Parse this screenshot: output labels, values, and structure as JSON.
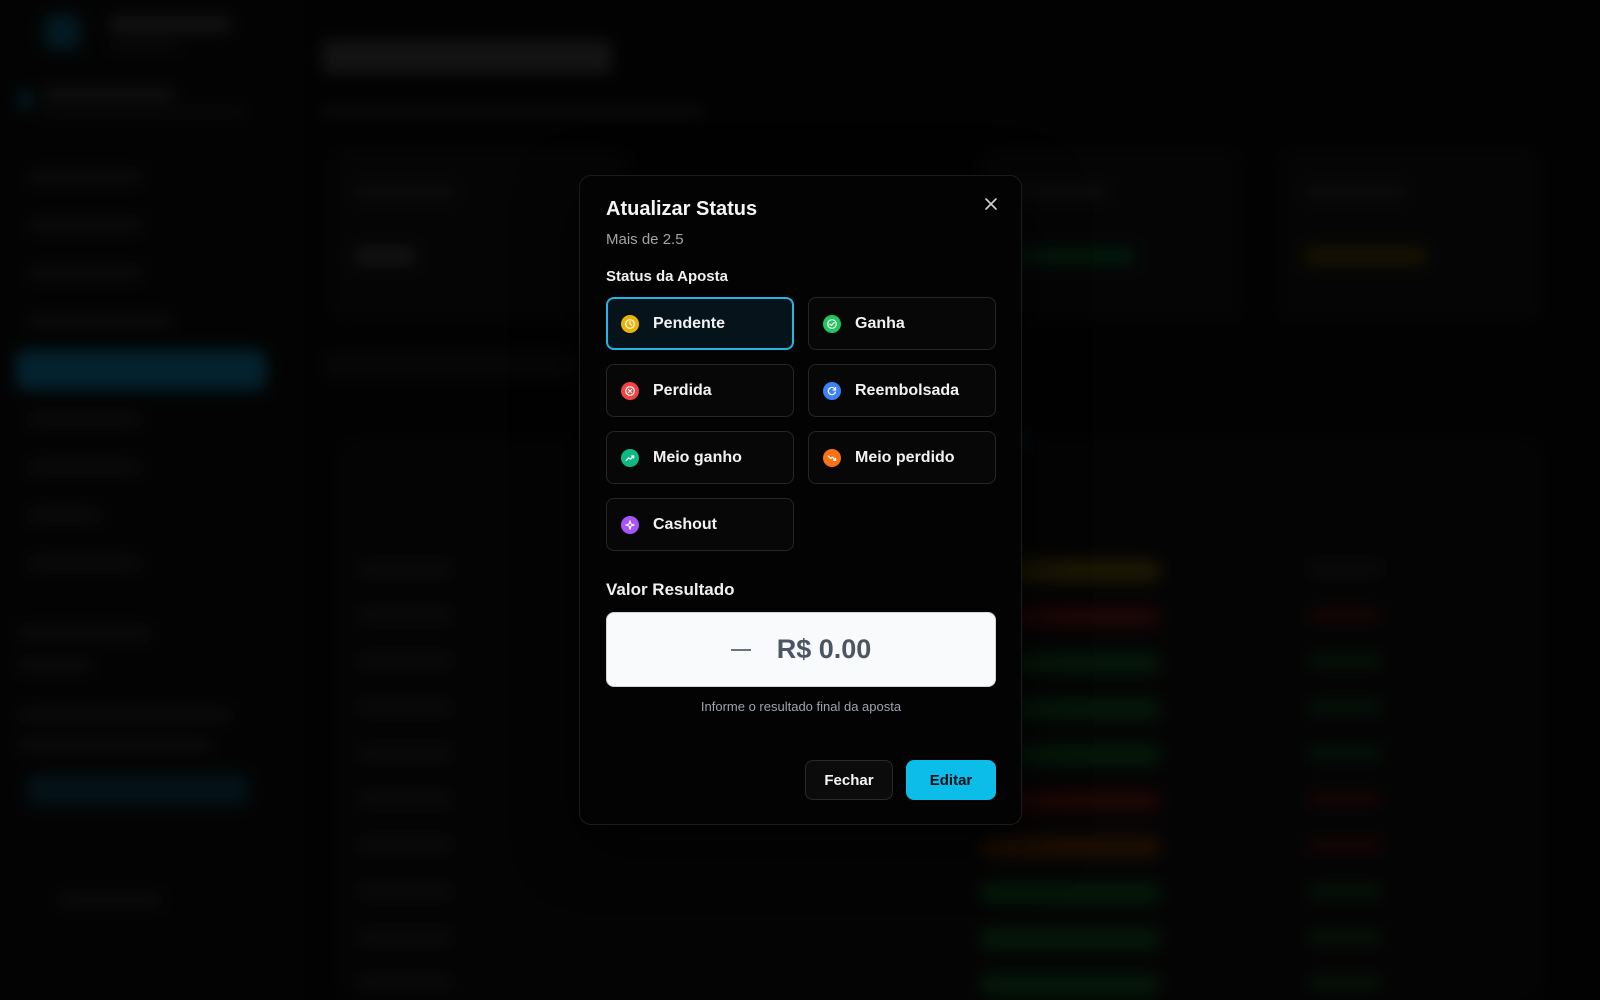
{
  "modal": {
    "title": "Atualizar Status",
    "subtitle": "Mais de 2.5",
    "status_section_label": "Status da Aposta",
    "status_options": [
      {
        "label": "Pendente",
        "icon": "clock-icon",
        "color": "#eab308",
        "selected": true
      },
      {
        "label": "Ganha",
        "icon": "check-circle-icon",
        "color": "#22c55e",
        "selected": false
      },
      {
        "label": "Perdida",
        "icon": "x-circle-icon",
        "color": "#ef4444",
        "selected": false
      },
      {
        "label": "Reembolsada",
        "icon": "refresh-icon",
        "color": "#3b82f6",
        "selected": false
      },
      {
        "label": "Meio ganho",
        "icon": "trending-up-icon",
        "color": "#10b981",
        "selected": false
      },
      {
        "label": "Meio perdido",
        "icon": "trending-down-icon",
        "color": "#f97316",
        "selected": false
      },
      {
        "label": "Cashout",
        "icon": "sparkle-icon",
        "color": "#a855f7",
        "selected": false
      }
    ],
    "valor_label": "Valor Resultado",
    "valor_value": "R$ 0.00",
    "valor_hint": "Informe o resultado final da aposta",
    "buttons": {
      "close": "Fechar",
      "edit": "Editar"
    }
  },
  "colors": {
    "accent": "#0bbde8",
    "selected_border": "#25b5e3"
  }
}
